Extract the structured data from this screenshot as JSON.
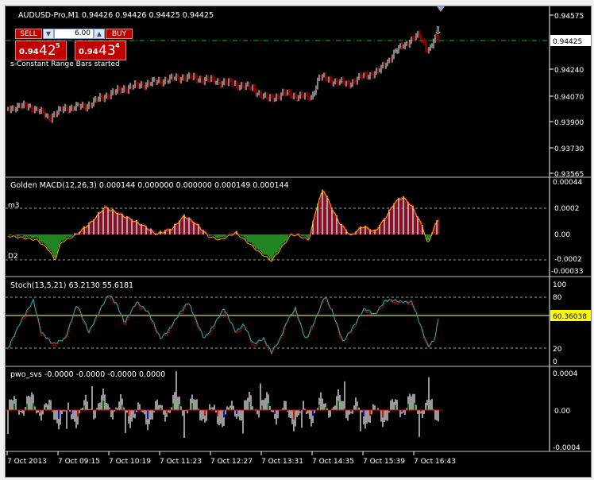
{
  "window": {
    "title": "AUDUSD-Pro,M1  0.94426 0.94426 0.94425 0.94425"
  },
  "trade_panel": {
    "sell_label": "SELL",
    "buy_label": "BUY",
    "lot_value": "6.00",
    "minus_glyph": "▼",
    "plus_glyph": "▲",
    "sell_price": {
      "small": "0.94",
      "big": "42",
      "sup": "5"
    },
    "buy_price": {
      "small": "0.94",
      "big": "43",
      "sup": "4"
    }
  },
  "main_pane": {
    "status_text": "s-Constant Range Bars started",
    "current_price": "0.94425",
    "price_ticks": [
      "0.94575",
      "0.94425",
      "0.94240",
      "0.94070",
      "0.93900",
      "0.93730",
      "0.93565"
    ],
    "colors": {
      "up": "#ffffff",
      "down": "#ff0000",
      "price_line": "#00c000"
    },
    "arrow_glyph": "⇩"
  },
  "macd_pane": {
    "title": "Golden MACD(12,26,3) 0.000144 0.000000 0.000000 0.000149 0.000144",
    "left_label_top": "m3",
    "left_label_bottom": "D2",
    "ticks": [
      "0.00044",
      "0.0002",
      "0.00",
      "-0.0002",
      "-0.00033"
    ],
    "colors": {
      "positive": "#dc143c",
      "negative": "#32cd32",
      "neutral": "#ffffff",
      "signal": "#ffa500"
    }
  },
  "stoch_pane": {
    "title": "Stoch(13,5,21) 63.2130 55.6181",
    "current_value": "60.36038",
    "ticks": [
      "100",
      "80",
      "20",
      "0"
    ],
    "colors": {
      "main": "#20b2aa",
      "signal": "#ff0000",
      "level": "#ffff99"
    }
  },
  "pwo_pane": {
    "title": "pwo_svs -0.0000 -0.0000 -0.0000 0.0000",
    "ticks": [
      "0.0004",
      "0.00",
      "-0.0004"
    ],
    "colors": {
      "fill": "#ffffff",
      "green": "#008000",
      "blue": "#0000ff",
      "red": "#ff0000"
    }
  },
  "time_axis": {
    "labels": [
      "7 Oct 2013",
      "7 Oct 09:15",
      "7 Oct 10:19",
      "7 Oct 11:23",
      "7 Oct 12:27",
      "7 Oct 13:31",
      "7 Oct 14:35",
      "7 Oct 15:39",
      "7 Oct 16:43"
    ]
  }
}
